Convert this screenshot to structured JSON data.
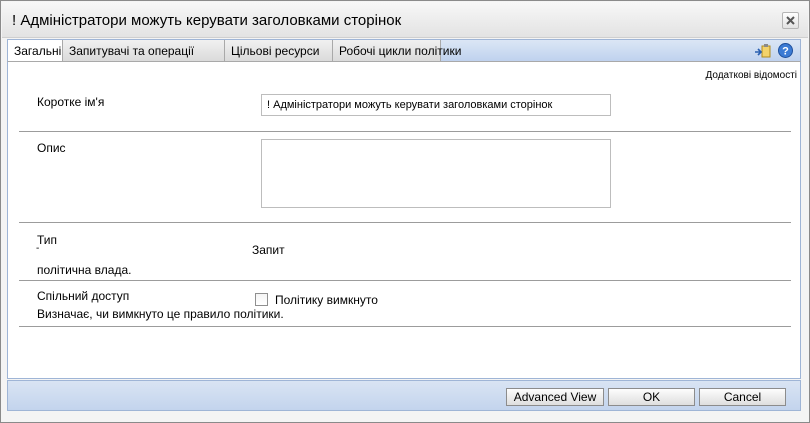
{
  "window": {
    "title": "! Адміністратори можуть керувати заголовками сторінок",
    "close_icon": "close-icon"
  },
  "tabs": [
    {
      "label": "Загальні",
      "active": true
    },
    {
      "label": "Запитувачі та операції",
      "active": false
    },
    {
      "label": "Цільові ресурси",
      "active": false
    },
    {
      "label": "Робочі цикли політики",
      "active": false
    }
  ],
  "toolbar_icons": [
    "export-icon",
    "help-icon"
  ],
  "more_info_link": "Додаткові відомості",
  "fields": {
    "short_name": {
      "label": "Коротке ім'я",
      "value": "! Адміністратори можуть керувати заголовками сторінок"
    },
    "description": {
      "label": "Опис",
      "value": ""
    },
    "type": {
      "label": "Тип",
      "marker": "-",
      "description": "політична влада.",
      "value": "Запит"
    },
    "disabled": {
      "label": "Спільний доступ",
      "description": "Визначає, чи вимкнуто це правило політики.",
      "checkbox_label": "Політику вимкнуто",
      "checked": false
    }
  },
  "buttons": {
    "advanced_view": "Advanced View",
    "ok": "OK",
    "cancel": "Cancel"
  }
}
